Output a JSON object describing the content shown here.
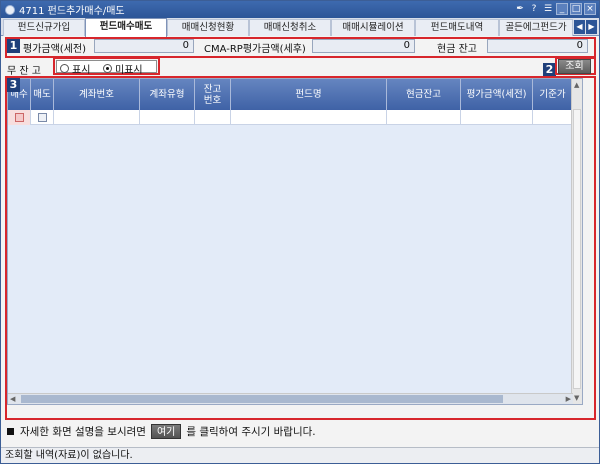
{
  "window": {
    "title": "4711 펀드추가매수/매도",
    "controls": [
      "pin",
      "help",
      "menu",
      "minimize",
      "maximize",
      "close"
    ]
  },
  "tabs": [
    {
      "label": "펀드신규가입",
      "active": false
    },
    {
      "label": "펀드매수매도",
      "active": true
    },
    {
      "label": "매매신청현황",
      "active": false
    },
    {
      "label": "매매신청취소",
      "active": false
    },
    {
      "label": "매매시뮬레이션",
      "active": false
    },
    {
      "label": "펀드매도내역",
      "active": false
    },
    {
      "label": "골든에그펀드가",
      "active": false
    }
  ],
  "badges": {
    "one": "1",
    "two": "2",
    "three": "3"
  },
  "summary": {
    "eval_pre_tax_label": "평가금액(세전)",
    "eval_pre_tax_value": "0",
    "cma_rp_label": "CMA-RP평가금액(세후)",
    "cma_rp_value": "0",
    "cash_balance_label": "현금 잔고",
    "cash_balance_value": "0"
  },
  "no_balance": {
    "label": "무 잔 고",
    "options": [
      {
        "label": "표시",
        "selected": false
      },
      {
        "label": "미표시",
        "selected": true
      }
    ]
  },
  "query_button": "조회",
  "grid": {
    "columns": [
      "매수",
      "매도",
      "계좌번호",
      "계좌유형",
      "잔고\n번호",
      "펀드명",
      "현금잔고",
      "평가금액(세전)",
      "기준가"
    ]
  },
  "help": {
    "before": "자세한 화면 설명을 보시려면",
    "button": "여기",
    "after": "를 클릭하여 주시기 바랍니다."
  },
  "status": "조회할 내역(자료)이 없습니다.",
  "colors": {
    "title_bar": "#2c5597",
    "highlight_frame": "#d7262c",
    "grid_header": "#4a6aad"
  }
}
